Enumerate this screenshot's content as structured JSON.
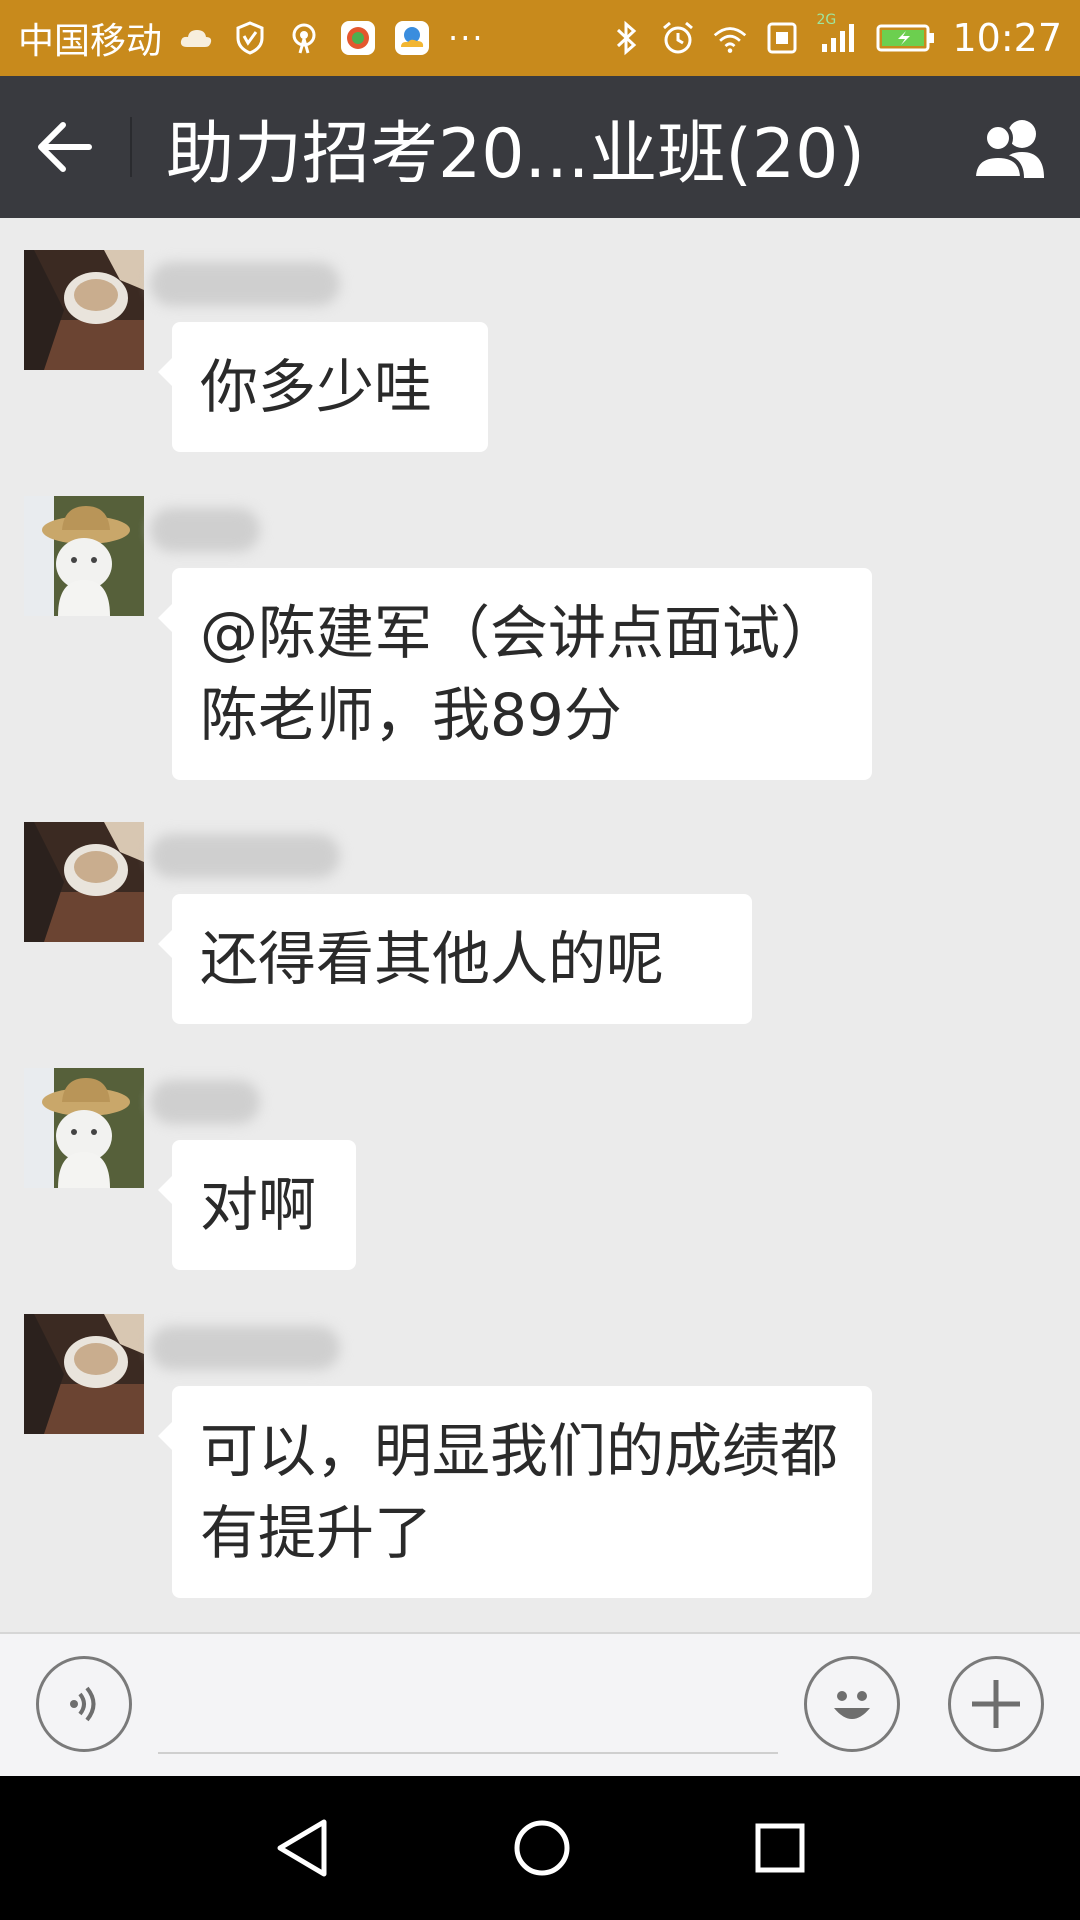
{
  "status_bar": {
    "carrier": "中国移动",
    "network_label": "2G",
    "time": "10:27",
    "overflow": "···",
    "colors": {
      "background": "#c88a1c"
    }
  },
  "header": {
    "title": "助力招考20...业班(20)",
    "back_icon": "arrow-left-icon",
    "members_icon": "group-members-icon",
    "colors": {
      "background": "#393a3f"
    }
  },
  "messages": [
    {
      "avatar": "avatar-coffee",
      "text": "你多少哇"
    },
    {
      "avatar": "avatar-cat-hat",
      "text": "@陈建军（会讲点面试）陈老师，我89分"
    },
    {
      "avatar": "avatar-coffee",
      "text": "还得看其他人的呢"
    },
    {
      "avatar": "avatar-cat-hat",
      "text": "对啊"
    },
    {
      "avatar": "avatar-coffee",
      "text": "可以，明显我们的成绩都有提升了"
    }
  ],
  "input_bar": {
    "voice_icon": "voice-icon",
    "emoji_icon": "emoji-icon",
    "plus_icon": "plus-icon"
  },
  "nav_bar": {
    "back_icon": "nav-back-icon",
    "home_icon": "nav-home-icon",
    "recents_icon": "nav-recents-icon"
  }
}
